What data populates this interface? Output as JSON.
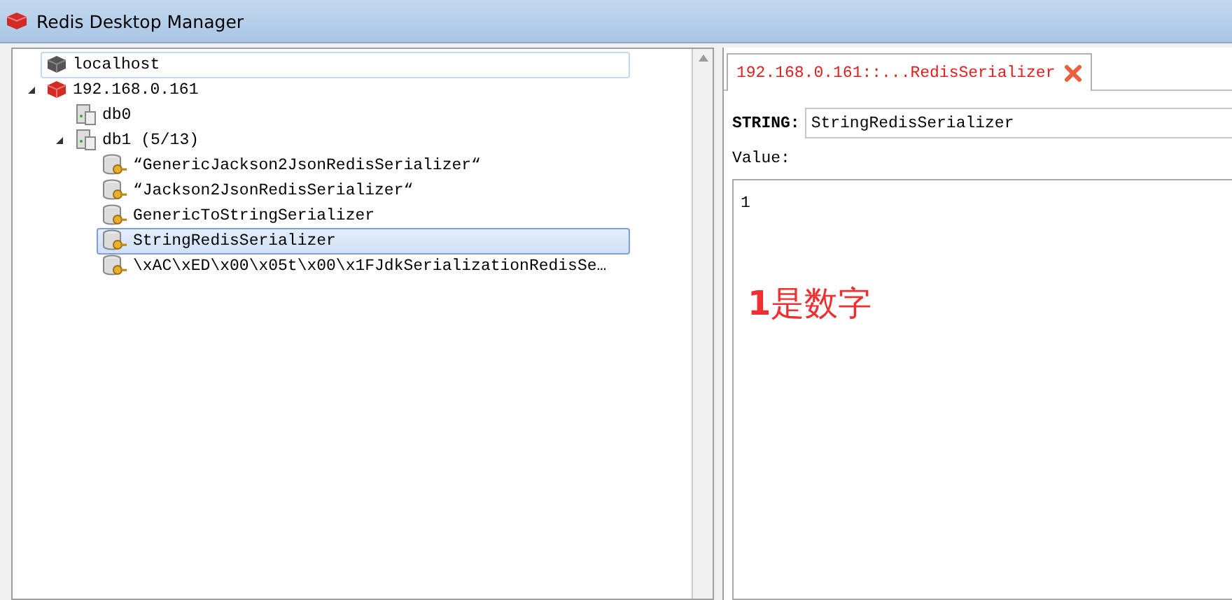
{
  "window": {
    "title": "Redis Desktop Manager"
  },
  "tree": [
    {
      "label": "localhost",
      "kind": "server",
      "connected": false,
      "focused": true,
      "selected": false
    },
    {
      "label": "192.168.0.161",
      "kind": "server",
      "connected": true,
      "focused": false,
      "selected": false,
      "expanded": true,
      "children": [
        {
          "label": "db0",
          "kind": "database",
          "selected": false
        },
        {
          "label": "db1 (5/13)",
          "kind": "database",
          "selected": false,
          "expanded": true,
          "children": [
            {
              "label": "“GenericJackson2JsonRedisSerializer“",
              "kind": "key",
              "selected": false
            },
            {
              "label": "“Jackson2JsonRedisSerializer“",
              "kind": "key",
              "selected": false
            },
            {
              "label": "GenericToStringSerializer",
              "kind": "key",
              "selected": false
            },
            {
              "label": "StringRedisSerializer",
              "kind": "key",
              "selected": true
            },
            {
              "label": "\\xAC\\xED\\x00\\x05t\\x00\\x1FJdkSerializationRedisSe…",
              "kind": "key",
              "selected": false
            }
          ]
        }
      ]
    }
  ],
  "tabs": [
    {
      "label": "192.168.0.161::...RedisSerializer",
      "selected": true
    }
  ],
  "editor": {
    "type_label": "STRING:",
    "key_value": "StringRedisSerializer",
    "value_label": "Value:",
    "value": "1"
  },
  "annotation": "1是数字"
}
